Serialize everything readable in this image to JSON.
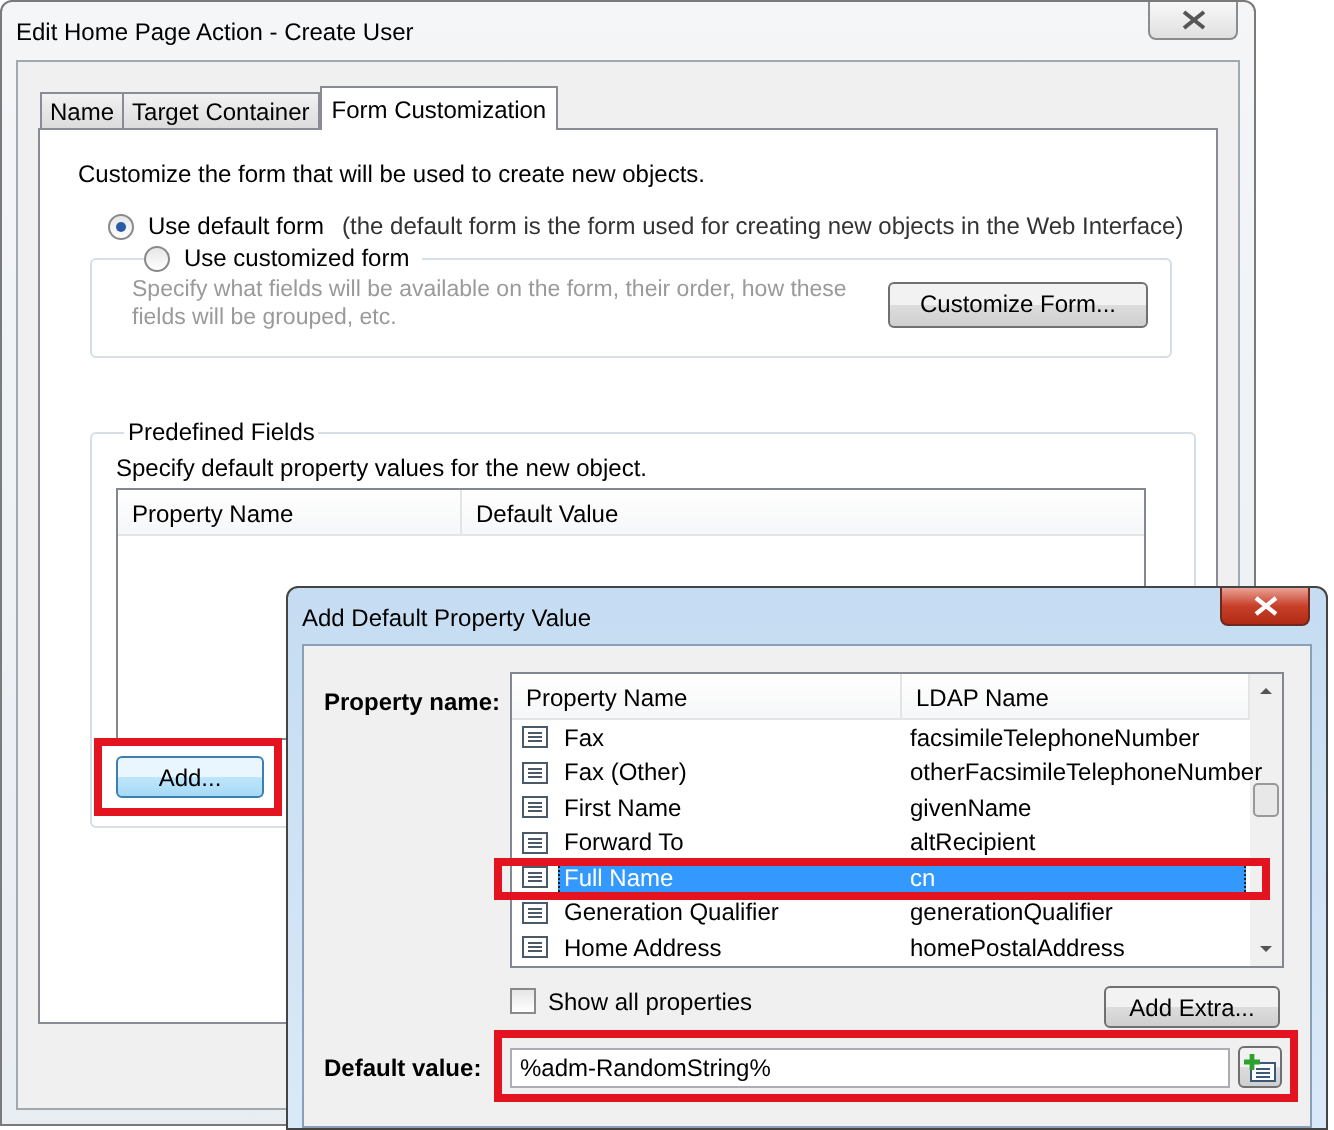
{
  "window": {
    "title": "Edit Home Page Action - Create User"
  },
  "tabs": [
    {
      "label": "Name",
      "selected": false
    },
    {
      "label": "Target Container",
      "selected": false
    },
    {
      "label": "Form Customization",
      "selected": true
    }
  ],
  "intro": "Customize the form that will be used to create new objects.",
  "form_options": [
    {
      "label": "Use default form",
      "note": "(the default form is the form used for creating new objects in the Web Interface)",
      "selected": true
    },
    {
      "label": "Use customized form",
      "selected": false,
      "description": "Specify what fields will be available on the form, their order, how these fields will be grouped, etc.",
      "button": "Customize Form..."
    }
  ],
  "predefined_fields": {
    "title": "Predefined Fields",
    "description": "Specify default property values for the new object.",
    "columns": [
      "Property Name",
      "Default Value"
    ],
    "add_button": {
      "label": "Add...",
      "highlighted": true
    }
  },
  "dialog": {
    "title": "Add Default Property Value",
    "property_label": "Property name:",
    "columns": [
      "Property Name",
      "LDAP Name"
    ],
    "rows": [
      {
        "name": "Fax",
        "ldap": "facsimileTelephoneNumber",
        "selected": false,
        "highlighted": false
      },
      {
        "name": "Fax (Other)",
        "ldap": "otherFacsimileTelephoneNumber",
        "selected": false,
        "highlighted": false
      },
      {
        "name": "First Name",
        "ldap": "givenName",
        "selected": false,
        "highlighted": false
      },
      {
        "name": "Forward To",
        "ldap": "altRecipient",
        "selected": false,
        "highlighted": false
      },
      {
        "name": "Full Name",
        "ldap": "cn",
        "selected": true,
        "highlighted": true
      },
      {
        "name": "Generation Qualifier",
        "ldap": "generationQualifier",
        "selected": false,
        "highlighted": false
      },
      {
        "name": "Home Address",
        "ldap": "homePostalAddress",
        "selected": false,
        "highlighted": false
      }
    ],
    "show_all": {
      "label": "Show all properties",
      "checked": false
    },
    "add_extra_button": "Add Extra...",
    "default_value": {
      "label": "Default value:",
      "value": "%adm-RandomString%",
      "highlighted": true
    }
  }
}
